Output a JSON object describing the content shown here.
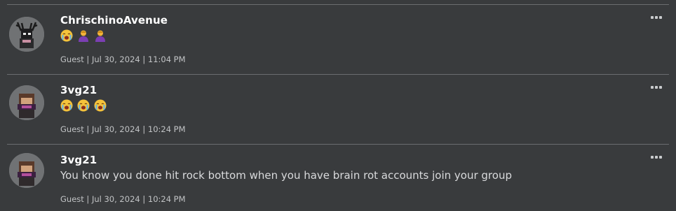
{
  "posts": [
    {
      "username": "ChrischinoAvenue",
      "text": "",
      "emojis": [
        "loudly-crying-face-emoji",
        "woman-bowing-emoji",
        "woman-bowing-emoji"
      ],
      "meta": "Guest | Jul 30, 2024 | 11:04 PM"
    },
    {
      "username": "3vg21",
      "text": "",
      "emojis": [
        "loudly-crying-face-emoji",
        "loudly-crying-face-emoji",
        "loudly-crying-face-emoji"
      ],
      "meta": "Guest | Jul 30, 2024 | 10:24 PM"
    },
    {
      "username": "3vg21",
      "text": "You know you done hit rock bottom when you have brain rot accounts join your group",
      "emojis": [],
      "meta": "Guest | Jul 30, 2024 | 10:24 PM"
    }
  ],
  "icons": {
    "more_options": "more-options-icon"
  },
  "colors": {
    "background": "#393b3d",
    "divider": "#6b6d70",
    "username": "#ffffff",
    "body_text": "#d9dadc",
    "meta_text": "#c1c3c5"
  }
}
